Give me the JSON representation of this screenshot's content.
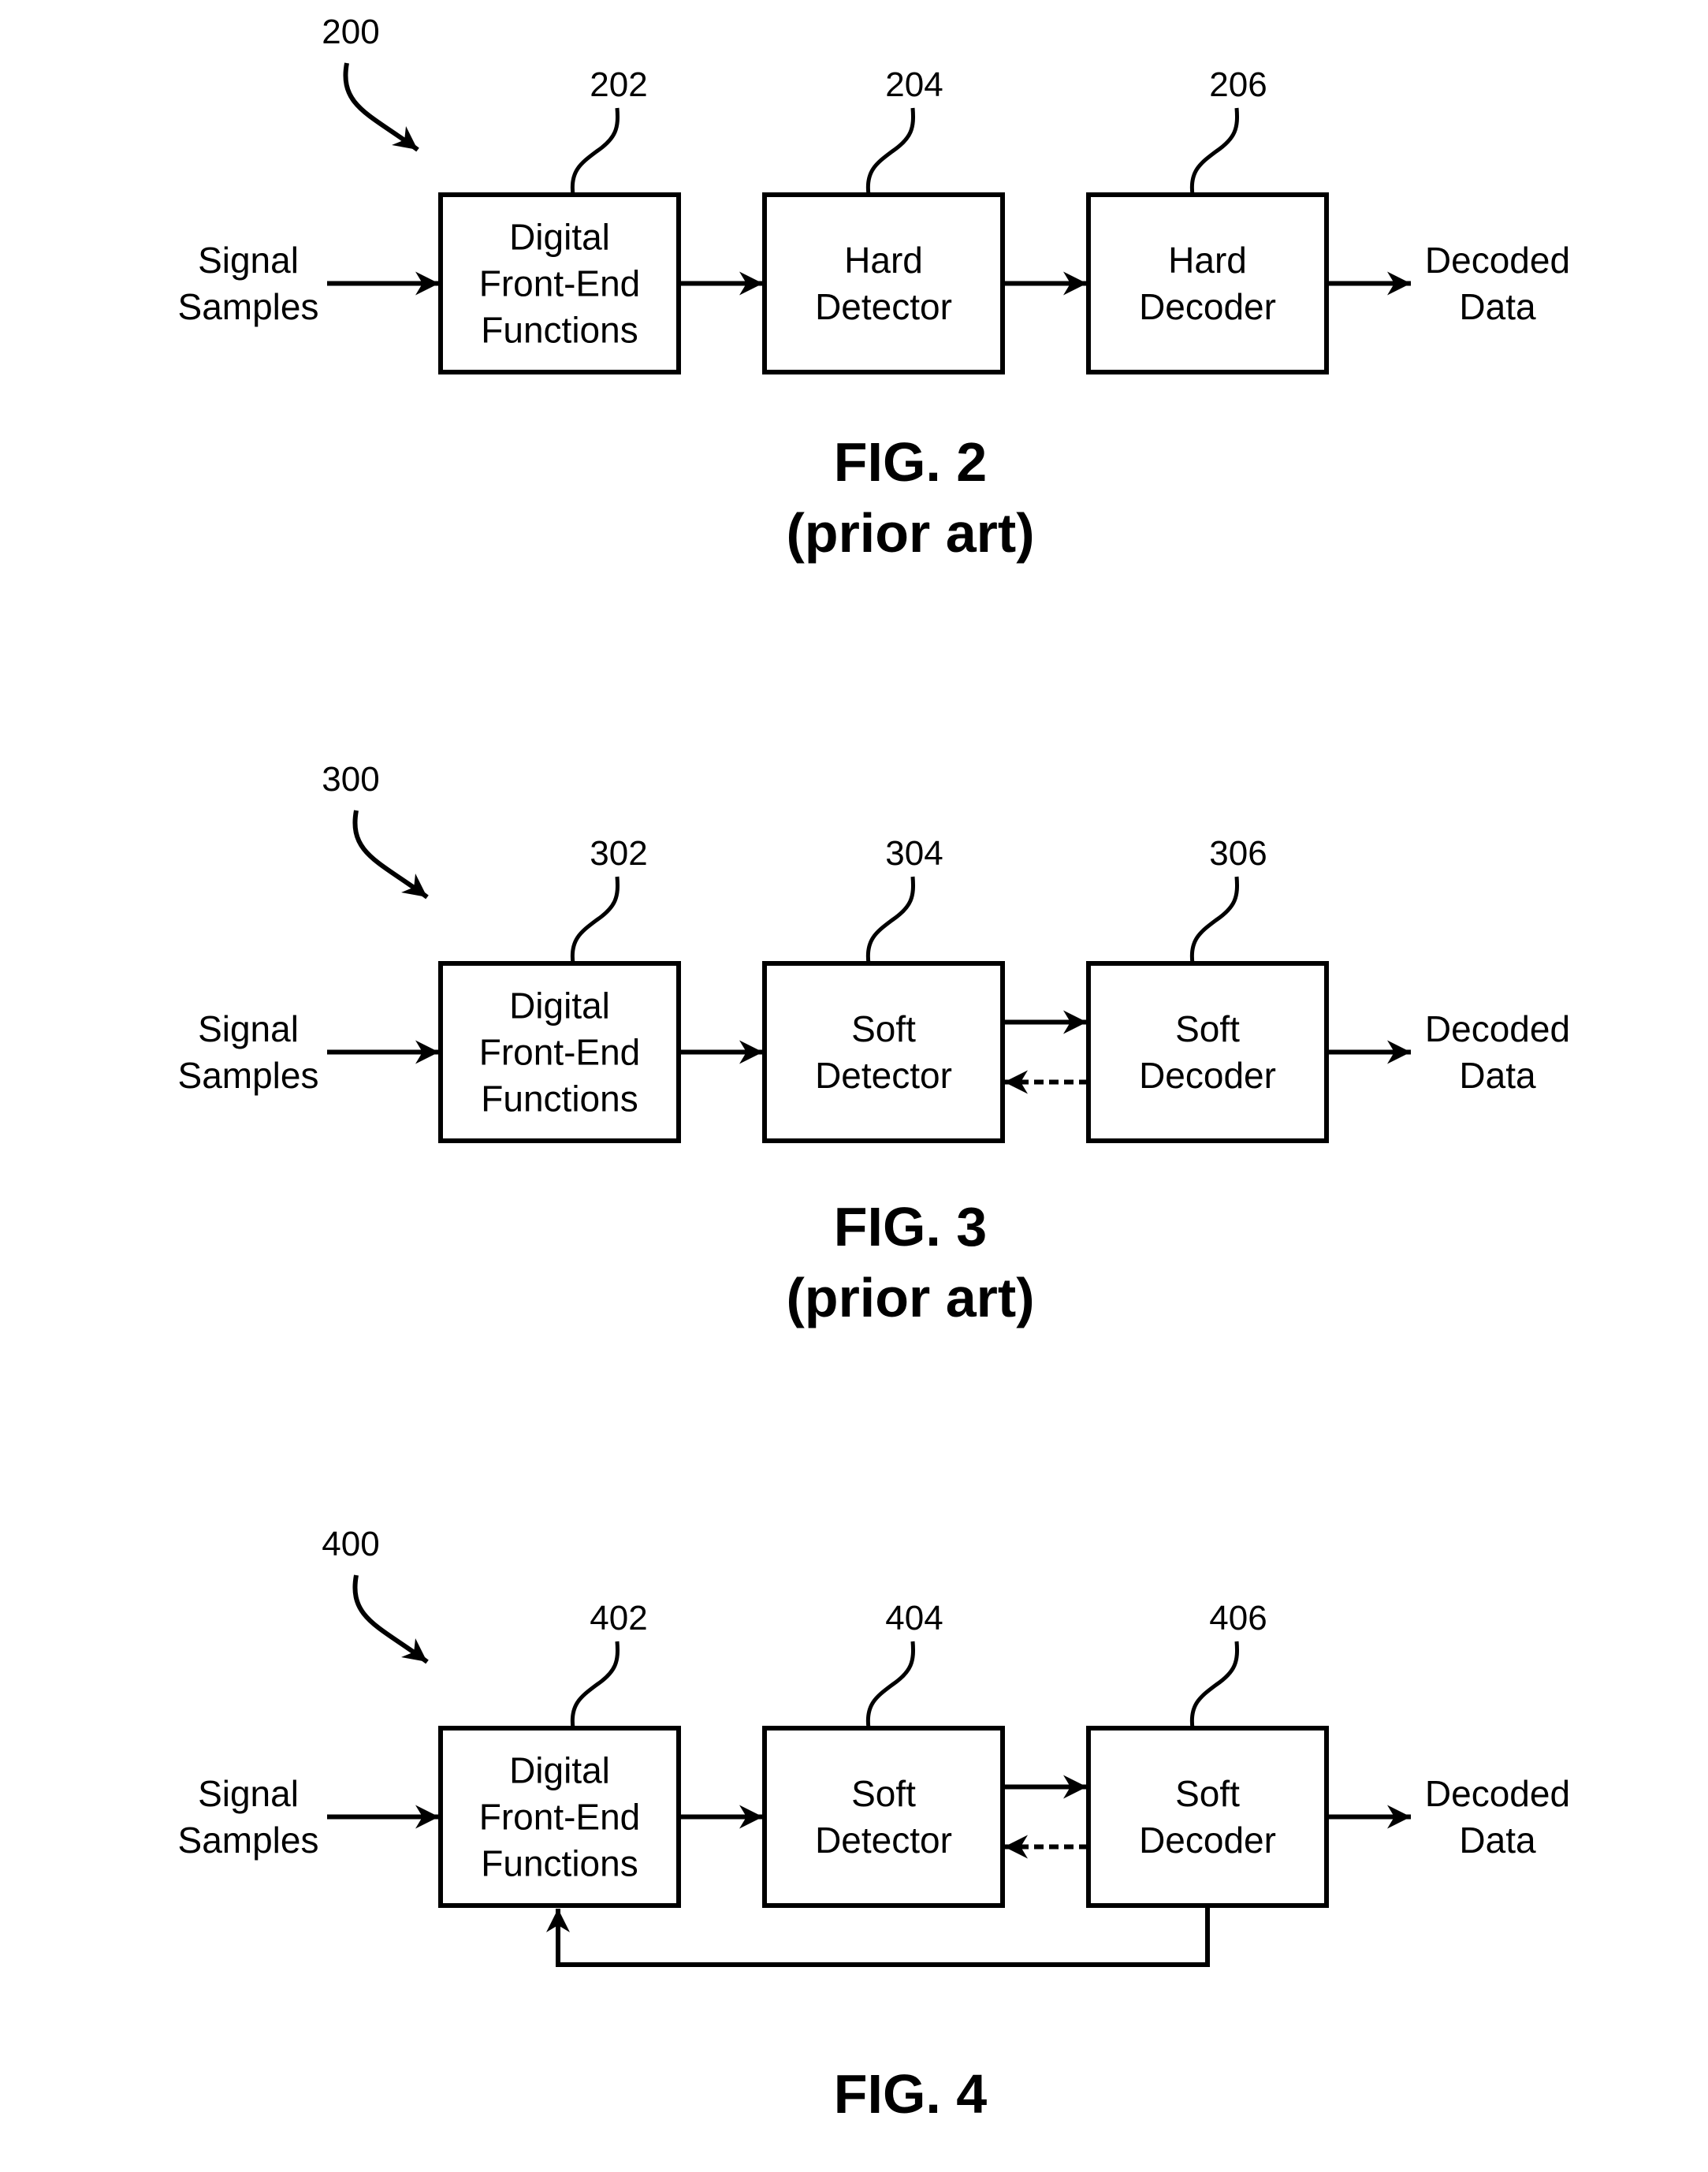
{
  "figures": [
    {
      "id": "fig2",
      "ref": "200",
      "caption": "FIG. 2",
      "subcaption": "(prior art)",
      "input_label": [
        "Signal",
        "Samples"
      ],
      "output_label": [
        "Decoded",
        "Data"
      ],
      "blocks": [
        {
          "ref": "202",
          "lines": [
            "Digital",
            "Front-End",
            "Functions"
          ]
        },
        {
          "ref": "204",
          "lines": [
            "Hard",
            "Detector"
          ]
        },
        {
          "ref": "206",
          "lines": [
            "Hard",
            "Decoder"
          ]
        }
      ],
      "bidirectional_detector_decoder": false,
      "decoder_feedback_to_frontend": false
    },
    {
      "id": "fig3",
      "ref": "300",
      "caption": "FIG. 3",
      "subcaption": "(prior art)",
      "input_label": [
        "Signal",
        "Samples"
      ],
      "output_label": [
        "Decoded",
        "Data"
      ],
      "blocks": [
        {
          "ref": "302",
          "lines": [
            "Digital",
            "Front-End",
            "Functions"
          ]
        },
        {
          "ref": "304",
          "lines": [
            "Soft",
            "Detector"
          ]
        },
        {
          "ref": "306",
          "lines": [
            "Soft",
            "Decoder"
          ]
        }
      ],
      "bidirectional_detector_decoder": true,
      "decoder_feedback_to_frontend": false
    },
    {
      "id": "fig4",
      "ref": "400",
      "caption": "FIG. 4",
      "subcaption": "",
      "input_label": [
        "Signal",
        "Samples"
      ],
      "output_label": [
        "Decoded",
        "Data"
      ],
      "blocks": [
        {
          "ref": "402",
          "lines": [
            "Digital",
            "Front-End",
            "Functions"
          ]
        },
        {
          "ref": "404",
          "lines": [
            "Soft",
            "Detector"
          ]
        },
        {
          "ref": "406",
          "lines": [
            "Soft",
            "Decoder"
          ]
        }
      ],
      "bidirectional_detector_decoder": true,
      "decoder_feedback_to_frontend": true
    }
  ]
}
